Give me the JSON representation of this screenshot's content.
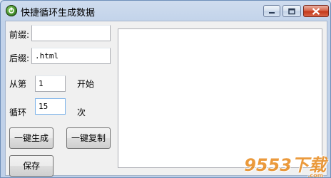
{
  "window": {
    "title": "快捷循环生成数据"
  },
  "form": {
    "prefix_label": "前缀:",
    "prefix_value": "",
    "suffix_label": "后缀:",
    "suffix_value": ".html",
    "from_label": "从第",
    "from_value": "1",
    "start_label": "开始",
    "loop_label": "循环",
    "loop_value": "15",
    "times_label": "次",
    "generate_button": "一键生成",
    "copy_button": "一键复制",
    "save_button": "保存"
  },
  "output": {
    "text": ""
  },
  "watermark": {
    "text": "9553下载",
    "sub": ".com"
  },
  "colors": {
    "titlebar": "#c2d3ea",
    "close_button": "#c53a1c",
    "watermark": "#e8891b"
  }
}
